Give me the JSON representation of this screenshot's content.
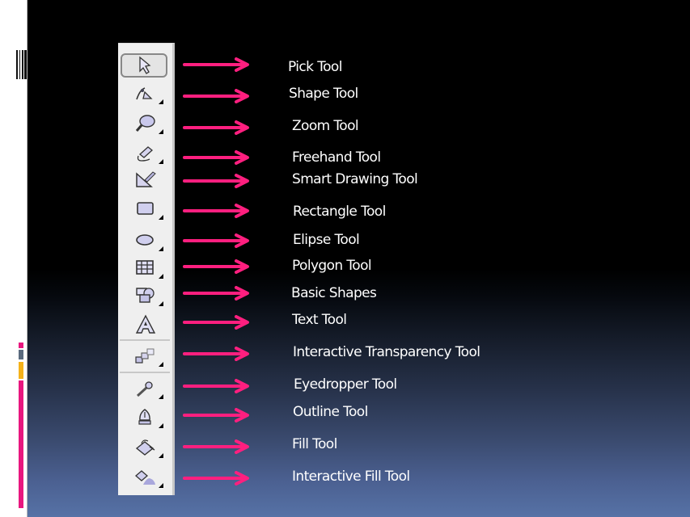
{
  "slide": {
    "colors": {
      "arrow": "#ff1f7f",
      "accent_pink": "#e8177f",
      "accent_gray": "#5a6a7e",
      "accent_yellow": "#f5b21a",
      "text": "#ffffff"
    }
  },
  "toolbar": {
    "tools": [
      {
        "icon": "pick-tool-icon",
        "label": "Pick Tool",
        "selected": true,
        "flyout": false
      },
      {
        "icon": "shape-tool-icon",
        "label": "Shape Tool",
        "flyout": true
      },
      {
        "icon": "zoom-tool-icon",
        "label": "Zoom Tool",
        "flyout": true
      },
      {
        "icon": "freehand-tool-icon",
        "label": "Freehand Tool",
        "flyout": true
      },
      {
        "icon": "smart-drawing-tool-icon",
        "label": "Smart Drawing Tool",
        "flyout": false
      },
      {
        "icon": "rectangle-tool-icon",
        "label": "Rectangle Tool",
        "flyout": true
      },
      {
        "icon": "ellipse-tool-icon",
        "label": "Elipse Tool",
        "flyout": true
      },
      {
        "icon": "polygon-tool-icon",
        "label": "Polygon Tool",
        "flyout": true
      },
      {
        "icon": "basic-shapes-icon",
        "label": "Basic Shapes",
        "flyout": true
      },
      {
        "icon": "text-tool-icon",
        "label": "Text Tool",
        "flyout": false
      },
      {
        "icon": "interactive-transparency-tool-icon",
        "label": "Interactive Transparency Tool",
        "flyout": true
      },
      {
        "icon": "eyedropper-tool-icon",
        "label": "Eyedropper Tool",
        "flyout": true
      },
      {
        "icon": "outline-tool-icon",
        "label": "Outline Tool",
        "flyout": true
      },
      {
        "icon": "fill-tool-icon",
        "label": "Fill Tool",
        "flyout": true
      },
      {
        "icon": "interactive-fill-tool-icon",
        "label": "Interactive Fill Tool",
        "flyout": true
      }
    ]
  }
}
